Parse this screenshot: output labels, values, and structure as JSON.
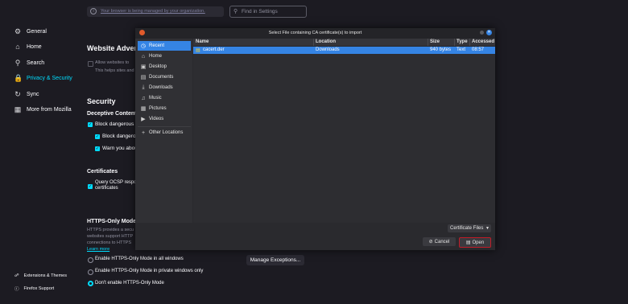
{
  "settings": {
    "notice": "Your browser is being managed by your organization.",
    "search_placeholder": "Find in Settings",
    "nav": [
      {
        "label": "General",
        "icon": "gear-icon"
      },
      {
        "label": "Home",
        "icon": "home-icon"
      },
      {
        "label": "Search",
        "icon": "search-icon"
      },
      {
        "label": "Privacy & Security",
        "icon": "lock-icon"
      },
      {
        "label": "Sync",
        "icon": "sync-icon"
      },
      {
        "label": "More from Mozilla",
        "icon": "mozilla-icon"
      }
    ],
    "footer": [
      {
        "label": "Extensions & Themes",
        "icon": "puzzle-icon"
      },
      {
        "label": "Firefox Support",
        "icon": "help-icon"
      }
    ],
    "website_adv_heading": "Website Adver",
    "website_adv_check": "Allow websites to",
    "website_adv_help": "This helps sites and",
    "security_heading": "Security",
    "deceptive_heading": "Deceptive Content",
    "block_dangerous_1": "Block dangerous a",
    "block_dangerous_2": "Block dangerous",
    "warn_you": "Warn you abou",
    "certificates_heading": "Certificates",
    "ocsp_line1": "Query OCSP respo",
    "ocsp_line2": "certificates",
    "https_heading": "HTTPS-Only Mode",
    "https_desc1": "HTTPS provides a secu",
    "https_desc2": "websites support HTTP",
    "https_desc3": "connections to HTTPS",
    "learn_more": "Learn more",
    "https_opt1": "Enable HTTPS-Only Mode in all windows",
    "https_opt2": "Enable HTTPS-Only Mode in private windows only",
    "https_opt3": "Don't enable HTTPS-Only Mode",
    "manage_exceptions": "Manage Exceptions..."
  },
  "dialog": {
    "title": "Select File containing CA certificate(s) to import",
    "places": [
      {
        "label": "Recent",
        "icon": "clock-icon"
      },
      {
        "label": "Home",
        "icon": "home-icon"
      },
      {
        "label": "Desktop",
        "icon": "desktop-icon"
      },
      {
        "label": "Documents",
        "icon": "document-icon"
      },
      {
        "label": "Downloads",
        "icon": "download-icon"
      },
      {
        "label": "Music",
        "icon": "music-icon"
      },
      {
        "label": "Pictures",
        "icon": "picture-icon"
      },
      {
        "label": "Videos",
        "icon": "video-icon"
      },
      {
        "label": "Other Locations",
        "icon": "plus-icon"
      }
    ],
    "columns": {
      "name": "Name",
      "location": "Location",
      "size": "Size",
      "type": "Type",
      "accessed": "Accessed"
    },
    "rows": [
      {
        "name": "cacert.der",
        "location": "Downloads",
        "size": "940 bytes",
        "type": "Text",
        "accessed": "08:57"
      }
    ],
    "filter": "Certificate Files",
    "cancel": "Cancel",
    "open": "Open"
  }
}
